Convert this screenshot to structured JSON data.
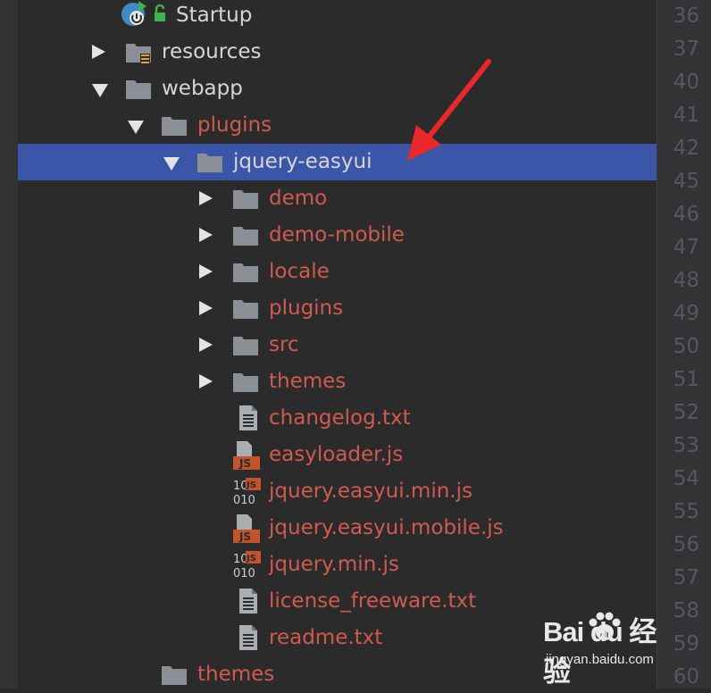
{
  "tree": {
    "rows": [
      {
        "label": "Startup",
        "color": "white",
        "kind": "run-config",
        "arrow": "none"
      },
      {
        "label": "resources",
        "color": "white",
        "kind": "folder-resources",
        "arrow": "right"
      },
      {
        "label": "webapp",
        "color": "white",
        "kind": "folder",
        "arrow": "down"
      },
      {
        "label": "plugins",
        "color": "red",
        "kind": "folder",
        "arrow": "down"
      },
      {
        "label": "jquery-easyui",
        "color": "white",
        "kind": "folder",
        "arrow": "down",
        "selected": true
      },
      {
        "label": "demo",
        "color": "red",
        "kind": "folder",
        "arrow": "right"
      },
      {
        "label": "demo-mobile",
        "color": "red",
        "kind": "folder",
        "arrow": "right"
      },
      {
        "label": "locale",
        "color": "red",
        "kind": "folder",
        "arrow": "right"
      },
      {
        "label": "plugins",
        "color": "red",
        "kind": "folder",
        "arrow": "right"
      },
      {
        "label": "src",
        "color": "red",
        "kind": "folder",
        "arrow": "right"
      },
      {
        "label": "themes",
        "color": "red",
        "kind": "folder",
        "arrow": "right"
      },
      {
        "label": "changelog.txt",
        "color": "red",
        "kind": "text-file",
        "arrow": "none"
      },
      {
        "label": "easyloader.js",
        "color": "red",
        "kind": "js-file",
        "arrow": "none"
      },
      {
        "label": "jquery.easyui.min.js",
        "color": "red",
        "kind": "min-js-file",
        "arrow": "none"
      },
      {
        "label": "jquery.easyui.mobile.js",
        "color": "red",
        "kind": "js-file",
        "arrow": "none"
      },
      {
        "label": "jquery.min.js",
        "color": "red",
        "kind": "min-js-file",
        "arrow": "none"
      },
      {
        "label": "license_freeware.txt",
        "color": "red",
        "kind": "text-file",
        "arrow": "none"
      },
      {
        "label": "readme.txt",
        "color": "red",
        "kind": "text-file",
        "arrow": "none"
      },
      {
        "label": "themes",
        "color": "red",
        "kind": "folder",
        "arrow": "none"
      }
    ]
  },
  "gutter": {
    "line_numbers": [
      "36",
      "37",
      "40",
      "41",
      "42",
      "45",
      "46",
      "47",
      "48",
      "49",
      "50",
      "51",
      "52",
      "53",
      "54",
      "55",
      "56",
      "57",
      "58",
      "59",
      "60"
    ]
  },
  "icons": {
    "js_badge": "JS",
    "binary_badge_top": "10",
    "binary_badge_bottom": "010"
  },
  "watermark": {
    "title": "Bai du 经验",
    "subtitle": "jingyan.baidu.com"
  },
  "colors": {
    "background": "#2b2b2b",
    "selection": "#3b56a8",
    "modified_red": "#d05a4e",
    "default_text": "#d6d6d6",
    "folder_gray": "#8b9096",
    "annotation_red": "#e8282a"
  }
}
